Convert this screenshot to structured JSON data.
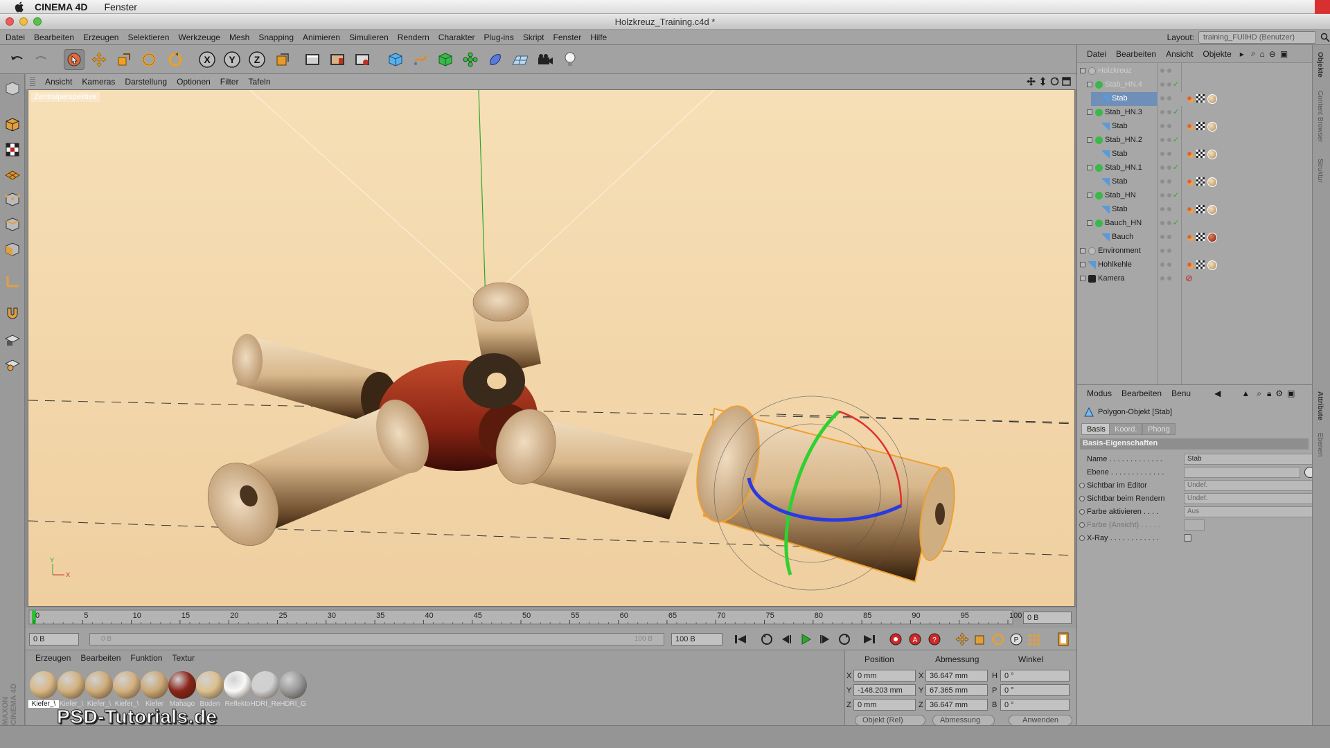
{
  "macmenu": {
    "app": "CINEMA 4D",
    "fenster": "Fenster"
  },
  "window": {
    "title": "Holzkreuz_Training.c4d *"
  },
  "appmenu": {
    "items": [
      "Datei",
      "Bearbeiten",
      "Erzeugen",
      "Selektieren",
      "Werkzeuge",
      "Mesh",
      "Snapping",
      "Animieren",
      "Simulieren",
      "Rendern",
      "Charakter",
      "Plug-ins",
      "Skript",
      "Fenster",
      "Hilfe"
    ],
    "layout_label": "Layout:",
    "layout_value": "training_FUllHD (Benutzer)"
  },
  "toolbar": {
    "x": "X",
    "y": "Y",
    "z": "Z"
  },
  "viewport": {
    "menu": [
      "Ansicht",
      "Kameras",
      "Darstellung",
      "Optionen",
      "Filter",
      "Tafeln"
    ],
    "camera_label": "Zentralperspektive",
    "axis_y": "Y",
    "axis_x": "X",
    "colors": {
      "background": "#f0d3a8",
      "wood_light": "#e7cba3",
      "wood_dark": "#3a2a1c",
      "mahogany": "#9a2c1c",
      "selection": "#f0a030"
    }
  },
  "timeline": {
    "ticks": [
      "0",
      "5",
      "10",
      "15",
      "20",
      "25",
      "30",
      "35",
      "40",
      "45",
      "50",
      "55",
      "60",
      "65",
      "70",
      "75",
      "80",
      "85",
      "90",
      "95",
      "100"
    ],
    "current_frame": "0 B",
    "start_field": "0 B",
    "range_start": "0 B",
    "range_end": "100 B",
    "end_field": "100 B"
  },
  "materials": {
    "menu": [
      "Erzeugen",
      "Bearbeiten",
      "Funktion",
      "Textur"
    ],
    "items": [
      {
        "label": "Kiefer_\\",
        "color": "#d8b886"
      },
      {
        "label": "Kiefer_\\",
        "color": "#d2b27f"
      },
      {
        "label": "Kiefer_\\",
        "color": "#cfad7b"
      },
      {
        "label": "Kiefer_\\",
        "color": "#d3b180"
      },
      {
        "label": "Kiefer",
        "color": "#cba877"
      },
      {
        "label": "Mahago",
        "color": "#8a2418"
      },
      {
        "label": "Boden",
        "color": "#dcc08e"
      },
      {
        "label": "Reflekto",
        "color": "#f8f8f8"
      },
      {
        "label": "HDRI_Re",
        "color": "#d0d0d0"
      },
      {
        "label": "HDRI_G",
        "color": "#9a9a9a"
      }
    ],
    "watermark": "PSD-Tutorials.de"
  },
  "coordinates": {
    "headers": [
      "Position",
      "Abmessung",
      "Winkel"
    ],
    "rows": [
      {
        "axis": "X",
        "pos": "0 mm",
        "size_axis": "X",
        "size": "36.647 mm",
        "rot_axis": "H",
        "rot": "0 °"
      },
      {
        "axis": "Y",
        "pos": "-148.203 mm",
        "size_axis": "Y",
        "size": "67.365 mm",
        "rot_axis": "P",
        "rot": "0 °"
      },
      {
        "axis": "Z",
        "pos": "0 mm",
        "size_axis": "Z",
        "size": "36.647 mm",
        "rot_axis": "B",
        "rot": "0 °"
      }
    ],
    "mode1": "Objekt (Rel)",
    "mode2": "Abmessung",
    "apply": "Anwenden"
  },
  "objects": {
    "menu": [
      "Datei",
      "Bearbeiten",
      "Ansicht",
      "Objekte"
    ],
    "tree": [
      {
        "name": "Holzkreuz",
        "indent": 0,
        "dim": true
      },
      {
        "name": "Stab_HN.4",
        "indent": 1,
        "dim": true
      },
      {
        "name": "Stab",
        "indent": 2,
        "selected": true
      },
      {
        "name": "Stab_HN.3",
        "indent": 1
      },
      {
        "name": "Stab",
        "indent": 2
      },
      {
        "name": "Stab_HN.2",
        "indent": 1
      },
      {
        "name": "Stab",
        "indent": 2
      },
      {
        "name": "Stab_HN.1",
        "indent": 1
      },
      {
        "name": "Stab",
        "indent": 2
      },
      {
        "name": "Stab_HN",
        "indent": 1
      },
      {
        "name": "Stab",
        "indent": 2
      },
      {
        "name": "Bauch_HN",
        "indent": 1
      },
      {
        "name": "Bauch",
        "indent": 2
      },
      {
        "name": "Environment",
        "indent": 0
      },
      {
        "name": "Hohlkehle",
        "indent": 0
      },
      {
        "name": "Kamera",
        "indent": 0
      }
    ]
  },
  "attributes": {
    "menu": [
      "Modus",
      "Bearbeiten",
      "Benu"
    ],
    "object_title": "Polygon-Objekt [Stab]",
    "tabs": [
      "Basis",
      "Koord.",
      "Phong"
    ],
    "section": "Basis-Eigenschaften",
    "rows": [
      {
        "label": "Name . . . . . . . . . . . . .",
        "value": "Stab"
      },
      {
        "label": "Ebene . . . . . . . . . . . . .",
        "value": ""
      },
      {
        "label": "Sichtbar im Editor",
        "value": "Undef."
      },
      {
        "label": "Sichtbar beim Rendern",
        "value": "Undef."
      },
      {
        "label": "Farbe aktivieren . . . .",
        "value": "Aus"
      },
      {
        "label": "Farbe (Ansicht) . . . . .",
        "value": ""
      },
      {
        "label": "X-Ray . . . . . . . . . . . .",
        "value": ""
      }
    ]
  },
  "sidetabs": [
    "Objekte",
    "Content Browser",
    "Struktur",
    "Attribute",
    "Ebenen"
  ],
  "maxon": "MAXON CINEMA 4D"
}
